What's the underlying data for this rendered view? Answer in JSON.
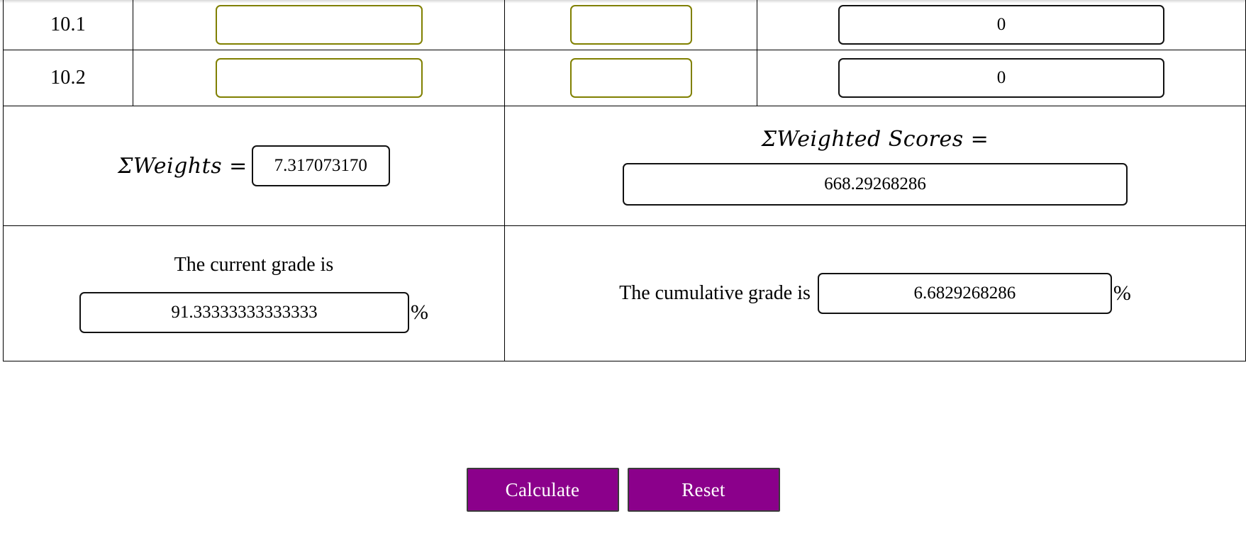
{
  "table": {
    "rows": [
      {
        "label": "10.1",
        "weight_value": "",
        "weight_placeholder": "",
        "score_value": "",
        "score_placeholder": "",
        "weighted_score_value": "0"
      },
      {
        "label": "10.2",
        "weight_value": "",
        "weight_placeholder": "",
        "score_value": "",
        "score_placeholder": "",
        "weighted_score_value": "0"
      }
    ]
  },
  "summary": {
    "sum_weights_label": "ΣWeights =",
    "sum_weights_value": "7.317073170",
    "sum_weighted_scores_label": "ΣWeighted Scores =",
    "sum_weighted_scores_value": "668.29268286"
  },
  "grades": {
    "current_label": "The current grade is",
    "current_value": "91.33333333333333",
    "current_percent_symbol": "%",
    "cumulative_label": "The cumulative grade is",
    "cumulative_value": "6.6829268286",
    "cumulative_percent_symbol": "%"
  },
  "buttons": {
    "calculate_label": "Calculate",
    "reset_label": "Reset"
  },
  "colors": {
    "input_border_olive": "#808000",
    "input_border_black": "#111111",
    "button_background": "#8B008B",
    "button_text": "#FFFFFF",
    "table_border": "#000000"
  }
}
